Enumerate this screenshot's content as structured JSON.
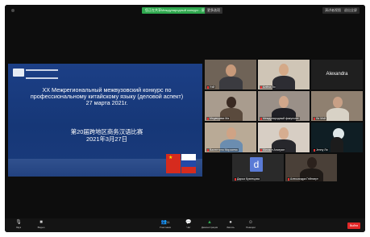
{
  "window": {
    "share_banner": "您正在共享Международный конкурс - 屏幕",
    "share_menu": "更多选项",
    "view_label": "演讲者视图",
    "fullscreen_label": "退出全屏"
  },
  "slide": {
    "title_lines": [
      "XX Межрегиональный межвузовский конкурс по",
      "профессиональному китайскому языку (деловой аспект)",
      "27 марта 2021г."
    ],
    "cn_lines": [
      "第20届跨地区商务汉语比赛",
      "2021年3月27日"
    ]
  },
  "participants": [
    {
      "name": "Уэй"
    },
    {
      "name": "Алёна Ли"
    },
    {
      "name": "Alexandra"
    },
    {
      "name": "Медведева Ма"
    },
    {
      "name": "Международный факультет"
    },
    {
      "name": "Ли Мэй"
    },
    {
      "name": "Валентина Мирзаева"
    },
    {
      "name": "Михаил Ансерин"
    },
    {
      "name": "Jenny Ли"
    },
    {
      "name": "Дарья Кузнецова",
      "initial": "d"
    },
    {
      "name": "Александра Гейнзерт"
    }
  ],
  "toolbar": {
    "audio": "Звук",
    "video": "Видео",
    "participants": "Участники",
    "participants_count": "11",
    "chat": "Чат",
    "share": "Демонстрация",
    "record": "Запись",
    "reactions": "Реакции",
    "end": "Выйти"
  },
  "colors": {
    "accent_green": "#2fa84f",
    "end_red": "#e02828",
    "slide_blue": "#1c3f86"
  }
}
